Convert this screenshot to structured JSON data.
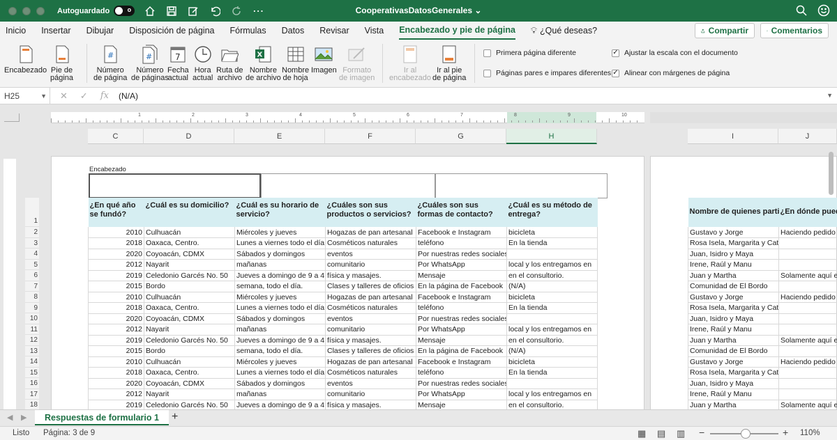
{
  "title_bar": {
    "autosave_label": "Autoguardado",
    "autosave_state": "o",
    "document_title": "CooperativasDatosGenerales"
  },
  "ribbon_tabs": [
    "Inicio",
    "Insertar",
    "Dibujar",
    "Disposición de página",
    "Fórmulas",
    "Datos",
    "Revisar",
    "Vista",
    "Encabezado y pie de página",
    "¿Qué deseas?"
  ],
  "share_label": "Compartir",
  "comments_label": "Comentarios",
  "ribbon": {
    "buttons": [
      {
        "label1": "Encabezado",
        "label2": ""
      },
      {
        "label1": "Pie de",
        "label2": "página"
      },
      {
        "label1": "Número",
        "label2": "de página"
      },
      {
        "label1": "Número",
        "label2": "de páginas"
      },
      {
        "label1": "Fecha",
        "label2": "actual"
      },
      {
        "label1": "Hora",
        "label2": "actual"
      },
      {
        "label1": "Ruta de",
        "label2": "archivo"
      },
      {
        "label1": "Nombre",
        "label2": "de archivo"
      },
      {
        "label1": "Nombre",
        "label2": "de hoja"
      },
      {
        "label1": "Imagen",
        "label2": ""
      },
      {
        "label1": "Formato",
        "label2": "de imagen"
      },
      {
        "label1": "Ir al",
        "label2": "encabezado"
      },
      {
        "label1": "Ir al pie",
        "label2": "de página"
      }
    ],
    "checkboxes": [
      {
        "label": "Primera página diferente",
        "checked": false
      },
      {
        "label": "Páginas pares e impares diferentes",
        "checked": false
      },
      {
        "label": "Ajustar la escala con el documento",
        "checked": true
      },
      {
        "label": "Alinear con márgenes de página",
        "checked": true
      }
    ]
  },
  "formula_bar": {
    "name_box": "H25",
    "formula": "(N/A)"
  },
  "ruler_numbers": [
    "1",
    "2",
    "3",
    "4",
    "5",
    "6",
    "7",
    "8",
    "9",
    "10"
  ],
  "columns": [
    "C",
    "D",
    "E",
    "F",
    "G",
    "H",
    "I",
    "J"
  ],
  "header_label": "Encabezado",
  "table": {
    "headers": [
      "¿En qué año se fundó?",
      "¿Cuál es su domicilio?",
      "¿Cuál es su horario de servicio?",
      "¿Cuáles son sus productos o servicios?",
      "¿Cuáles son sus formas de contacto?",
      "¿Cuál es su método de entrega?"
    ],
    "headers2": [
      "Nombre de quienes parti",
      "¿En dónde pued"
    ],
    "rows": [
      [
        "2010",
        "Culhuacán",
        "Miércoles y jueves",
        "Hogazas de pan artesanal",
        "Facebook e Instagram",
        "bicicleta",
        "Gustavo y Jorge",
        "Haciendo pedido p"
      ],
      [
        "2018",
        "Oaxaca, Centro.",
        "Lunes a viernes todo el día",
        "Cosméticos naturales",
        "teléfono",
        "En la tienda",
        "Rosa Isela, Margarita y Catalina",
        ""
      ],
      [
        "2020",
        "Coyoacán, CDMX",
        "Sábados y domingos",
        "eventos",
        "Por nuestras redes sociales",
        "",
        "Juan, Isidro y Maya",
        ""
      ],
      [
        "2012",
        "Nayarit",
        "mañanas",
        "comunitario",
        "Por WhatsApp",
        "local y los entregamos en",
        "Irene, Raúl y Manu",
        ""
      ],
      [
        "2019",
        "Celedonio Garcés No. 50",
        "Jueves a domingo de 9 a 4",
        "física y masajes.",
        "Mensaje",
        "en el consultorio.",
        "Juan y Martha",
        "Solamente aquí en"
      ],
      [
        "2015",
        "Bordo",
        "semana, todo el día.",
        "Clases y talleres de oficios",
        "En la página de Facebook",
        "(N/A)",
        "Comunidad de El Bordo",
        ""
      ],
      [
        "2010",
        "Culhuacán",
        "Miércoles y jueves",
        "Hogazas de pan artesanal",
        "Facebook e Instagram",
        "bicicleta",
        "Gustavo y Jorge",
        "Haciendo pedido p"
      ],
      [
        "2018",
        "Oaxaca, Centro.",
        "Lunes a viernes todo el día",
        "Cosméticos naturales",
        "teléfono",
        "En la tienda",
        "Rosa Isela, Margarita y Catalina",
        ""
      ],
      [
        "2020",
        "Coyoacán, CDMX",
        "Sábados y domingos",
        "eventos",
        "Por nuestras redes sociales",
        "",
        "Juan, Isidro y Maya",
        ""
      ],
      [
        "2012",
        "Nayarit",
        "mañanas",
        "comunitario",
        "Por WhatsApp",
        "local y los entregamos en",
        "Irene, Raúl y Manu",
        ""
      ],
      [
        "2019",
        "Celedonio Garcés No. 50",
        "Jueves a domingo de 9 a 4",
        "física y masajes.",
        "Mensaje",
        "en el consultorio.",
        "Juan y Martha",
        "Solamente aquí en"
      ],
      [
        "2015",
        "Bordo",
        "semana, todo el día.",
        "Clases y talleres de oficios",
        "En la página de Facebook",
        "(N/A)",
        "Comunidad de El Bordo",
        ""
      ],
      [
        "2010",
        "Culhuacán",
        "Miércoles y jueves",
        "Hogazas de pan artesanal",
        "Facebook e Instagram",
        "bicicleta",
        "Gustavo y Jorge",
        "Haciendo pedido p"
      ],
      [
        "2018",
        "Oaxaca, Centro.",
        "Lunes a viernes todo el día",
        "Cosméticos naturales",
        "teléfono",
        "En la tienda",
        "Rosa Isela, Margarita y Catalina",
        ""
      ],
      [
        "2020",
        "Coyoacán, CDMX",
        "Sábados y domingos",
        "eventos",
        "Por nuestras redes sociales",
        "",
        "Juan, Isidro y Maya",
        ""
      ],
      [
        "2012",
        "Nayarit",
        "mañanas",
        "comunitario",
        "Por WhatsApp",
        "local y los entregamos en",
        "Irene, Raúl y Manu",
        ""
      ],
      [
        "2019",
        "Celedonio Garcés No. 50",
        "Jueves a domingo de 9 a 4",
        "física y masajes.",
        "Mensaje",
        "en el consultorio.",
        "Juan y Martha",
        "Solamente aquí en"
      ]
    ]
  },
  "sheet_tab": "Respuestas de formulario 1",
  "status": {
    "ready": "Listo",
    "page": "Página: 3 de 9",
    "zoom": "110%"
  }
}
